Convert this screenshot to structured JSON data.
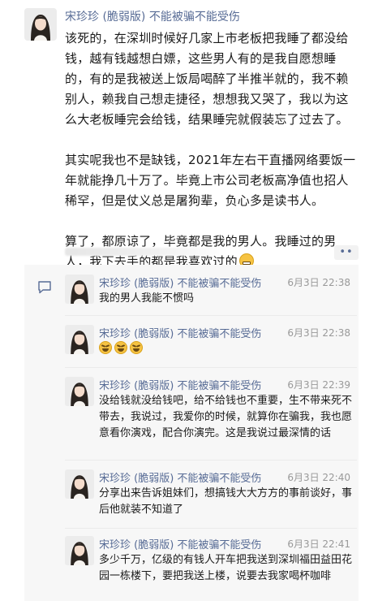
{
  "post": {
    "author": "宋珍珍 (脆弱版) 不能被骗不能受伤",
    "paragraphs": [
      "该死的，在深圳时候好几家上市老板把我睡了都没给钱，越有钱越想白嫖，这些男人有的是我自愿想睡的，有的是我被送上饭局喝醉了半推半就的，我不赖别人，赖我自己想走捷径，想想我又哭了，我以为这么大老板睡完会给钱，结果睡完就假装忘了过去了。",
      "其实呢我也不是缺钱，2021年左右干直播网络要饭一年就能挣几十万了。毕竟上市公司老板高净值也招人稀罕，但是仗义总是屠狗辈，负心多是读书人。",
      "算了，都原谅了，毕竟都是我的男人。我睡过的男人，我下去手的都是我喜欢过的"
    ],
    "more_icon": "••"
  },
  "comments": [
    {
      "name": "宋珍珍 (脆弱版) 不能被骗不能受伤",
      "time": "6月3日 22:38",
      "text": "我的男人我能不惯吗"
    },
    {
      "name": "宋珍珍 (脆弱版) 不能被骗不能受伤",
      "time": "6月3日 22:38",
      "text": "",
      "emoji": [
        "grimace-emoji",
        "grimace-emoji",
        "grimace-emoji"
      ]
    },
    {
      "name": "宋珍珍 (脆弱版) 不能被骗不能受伤",
      "time": "6月3日 22:39",
      "text": "没给钱就没给钱吧，给不给钱也不重要，生不带来死不带去，我说过，我爱你的时候，就算你在骗我，我也愿意看你演戏，配合你演完。这是我说过最深情的话"
    },
    {
      "name": "宋珍珍 (脆弱版) 不能被骗不能受伤",
      "time": "6月3日 22:40",
      "text": "分享出来告诉姐妹们，想搞钱大大方方的事前谈好，事后他就装不知道了"
    },
    {
      "name": "宋珍珍 (脆弱版) 不能被骗不能受伤",
      "time": "6月3日 22:41",
      "text": "多少千万，亿级的有钱人开车把我送到深圳福田益田花园一栋楼下，要把我送上楼，说要去我家喝杯咖啡"
    }
  ],
  "colors": {
    "name_link": "#576b95",
    "time_gray": "#999999",
    "comment_bg": "#f7f7f7"
  }
}
